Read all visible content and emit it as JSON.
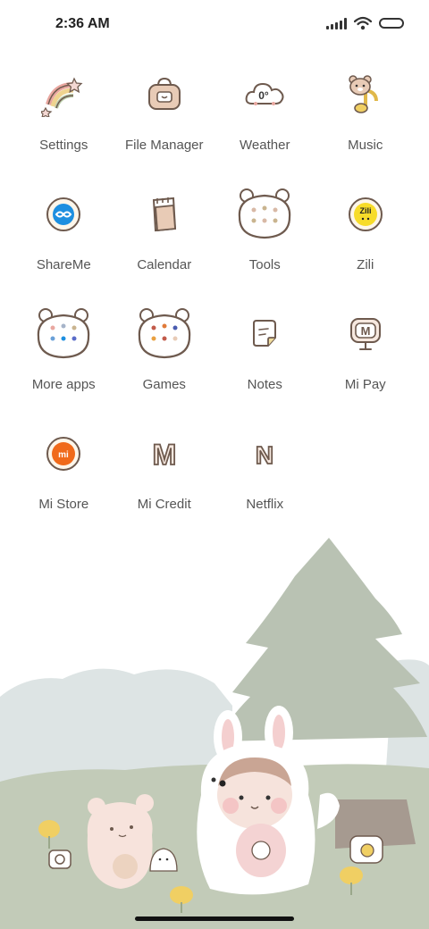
{
  "status_bar": {
    "time": "2:36 AM",
    "icons": [
      "signal-icon",
      "wifi-icon",
      "battery-icon"
    ]
  },
  "apps": [
    {
      "label": "Settings",
      "icon": "rainbow-star-icon"
    },
    {
      "label": "File Manager",
      "icon": "bag-icon"
    },
    {
      "label": "Weather",
      "icon": "cloud-icon"
    },
    {
      "label": "Music",
      "icon": "bear-note-icon"
    },
    {
      "label": "ShareMe",
      "icon": "shareme-icon"
    },
    {
      "label": "Calendar",
      "icon": "calendar-icon"
    },
    {
      "label": "Tools",
      "icon": "bear-folder-icon"
    },
    {
      "label": "Zili",
      "icon": "zili-icon"
    },
    {
      "label": "More apps",
      "icon": "bear-folder-icon"
    },
    {
      "label": "Games",
      "icon": "bear-folder-icon"
    },
    {
      "label": "Notes",
      "icon": "notes-icon"
    },
    {
      "label": "Mi Pay",
      "icon": "mipay-icon"
    },
    {
      "label": "Mi Store",
      "icon": "mistore-icon"
    },
    {
      "label": "Mi Credit",
      "icon": "letter-m-icon"
    },
    {
      "label": "Netflix",
      "icon": "letter-n-icon"
    }
  ],
  "icon_texts": {
    "weather_temp": "0°",
    "zili_text": "Zili",
    "mipay_letter": "M",
    "mistore_text": "mi",
    "micredit_letter": "M",
    "netflix_letter": "N"
  },
  "colors": {
    "label_text": "#555555",
    "icon_outline": "#6e5a4e",
    "mi_orange": "#f06a1a",
    "shareme_blue": "#1d8fe0",
    "tree_green": "#b9c2b3",
    "ground_green": "#c2cbb8",
    "hill_gray": "#d9e1e1"
  }
}
